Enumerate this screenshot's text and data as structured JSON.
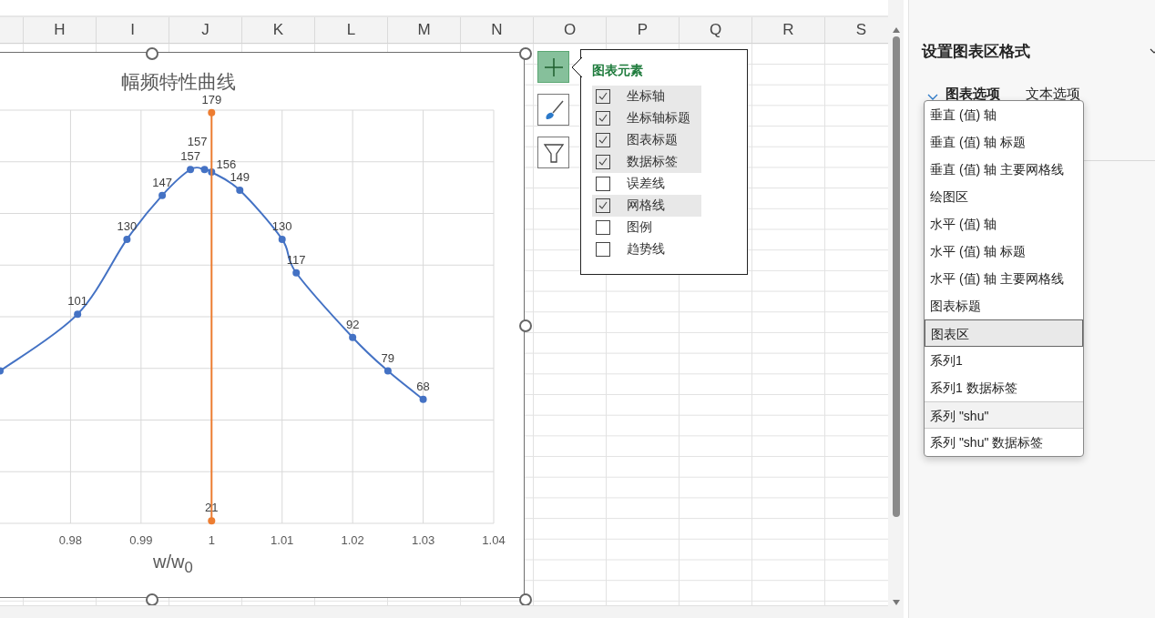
{
  "sheet": {
    "columns": [
      {
        "label": "H"
      },
      {
        "label": "I"
      },
      {
        "label": "J"
      },
      {
        "label": "K"
      },
      {
        "label": "L"
      },
      {
        "label": "M"
      },
      {
        "label": "N"
      },
      {
        "label": "O"
      },
      {
        "label": "P"
      },
      {
        "label": "Q"
      },
      {
        "label": "R"
      },
      {
        "label": "S"
      }
    ]
  },
  "chart": {
    "title": "幅频特性曲线",
    "xlabel": "w/w$_{0}$",
    "chart_data": {
      "type": "line",
      "xlim": [
        0.97,
        1.04
      ],
      "ylim": [
        20,
        180
      ],
      "xticks": [
        0.98,
        0.99,
        1,
        1.01,
        1.02,
        1.03,
        1.04
      ],
      "grid": true,
      "series": [
        {
          "color": "#4472c4",
          "marker": true,
          "x": [
            0.97,
            0.981,
            0.988,
            0.993,
            0.997,
            0.999,
            1.0,
            1.004,
            1.01,
            1.012,
            1.02,
            1.025,
            1.03
          ],
          "values": [
            79,
            101,
            130,
            147,
            157,
            157,
            156,
            149,
            130,
            117,
            92,
            79,
            68
          ],
          "value_labels": [
            null,
            "101",
            "130",
            "147",
            "157",
            "157",
            "156",
            "149",
            "130",
            "117",
            "92",
            "79",
            "68"
          ]
        },
        {
          "color": "#ed7d31",
          "marker": true,
          "x": [
            1.0,
            1.0
          ],
          "values": [
            21,
            179
          ],
          "value_labels": [
            "21",
            "179"
          ]
        }
      ]
    }
  },
  "chart_tools": [
    {
      "kind": "add",
      "selected": true
    },
    {
      "kind": "style",
      "selected": false
    },
    {
      "kind": "filter",
      "selected": false
    }
  ],
  "chart_elements": {
    "title": "图表元素",
    "items": [
      {
        "label": "坐标轴",
        "checked": true
      },
      {
        "label": "坐标轴标题",
        "checked": true
      },
      {
        "label": "图表标题",
        "checked": true
      },
      {
        "label": "数据标签",
        "checked": true
      },
      {
        "label": "误差线",
        "checked": false
      },
      {
        "label": "网格线",
        "checked": true
      },
      {
        "label": "图例",
        "checked": false
      },
      {
        "label": "趋势线",
        "checked": false
      }
    ]
  },
  "format_pane": {
    "title": "设置图表区格式",
    "tabs": [
      {
        "label": "图表选项",
        "selected": true
      },
      {
        "label": "文本选项",
        "selected": false
      }
    ],
    "element_list": [
      {
        "label": "垂直 (值) 轴",
        "selected": false,
        "hovered": false
      },
      {
        "label": "垂直 (值) 轴 标题",
        "selected": false,
        "hovered": false
      },
      {
        "label": "垂直 (值) 轴 主要网格线",
        "selected": false,
        "hovered": false
      },
      {
        "label": "绘图区",
        "selected": false,
        "hovered": false
      },
      {
        "label": "水平 (值) 轴",
        "selected": false,
        "hovered": false
      },
      {
        "label": "水平 (值) 轴 标题",
        "selected": false,
        "hovered": false
      },
      {
        "label": "水平 (值) 轴 主要网格线",
        "selected": false,
        "hovered": false
      },
      {
        "label": "图表标题",
        "selected": false,
        "hovered": false
      },
      {
        "label": "图表区",
        "selected": true,
        "hovered": false
      },
      {
        "label": "系列1",
        "selected": false,
        "hovered": false
      },
      {
        "label": "系列1 数据标签",
        "selected": false,
        "hovered": false
      },
      {
        "label": "系列 \"shu\"",
        "selected": false,
        "hovered": true
      },
      {
        "label": "系列 \"shu\" 数据标签",
        "selected": false,
        "hovered": false
      }
    ]
  }
}
